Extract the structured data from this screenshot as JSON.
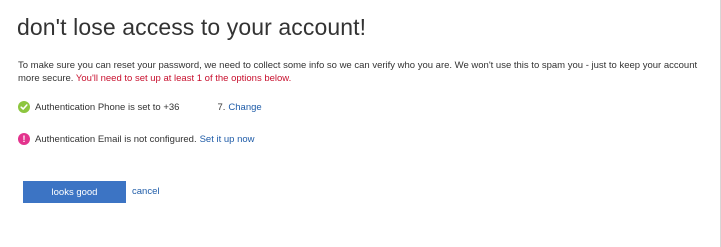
{
  "header": {
    "title": "don't lose access to your account!"
  },
  "intro": {
    "text": "To make sure you can reset your password, we need to collect some info so we can verify who you are. We won't use this to spam you - just to keep your account more secure. ",
    "warning": "You'll need to set up at least 1 of the options below."
  },
  "methods": {
    "phone": {
      "icon": "checkmark-icon",
      "text": "Authentication Phone is set to +36",
      "suffix": "7.",
      "link": "Change",
      "status_color": "#8dc63f"
    },
    "email": {
      "icon": "exclamation-icon",
      "icon_glyph": "!",
      "text": "Authentication Email is not configured.",
      "link": "Set it up now",
      "status_color": "#e3338d"
    }
  },
  "actions": {
    "confirm_label": "looks good",
    "cancel_label": "cancel"
  },
  "colors": {
    "accent": "#3c74c4",
    "link": "#1f5ca8",
    "warning": "#c8102e"
  }
}
